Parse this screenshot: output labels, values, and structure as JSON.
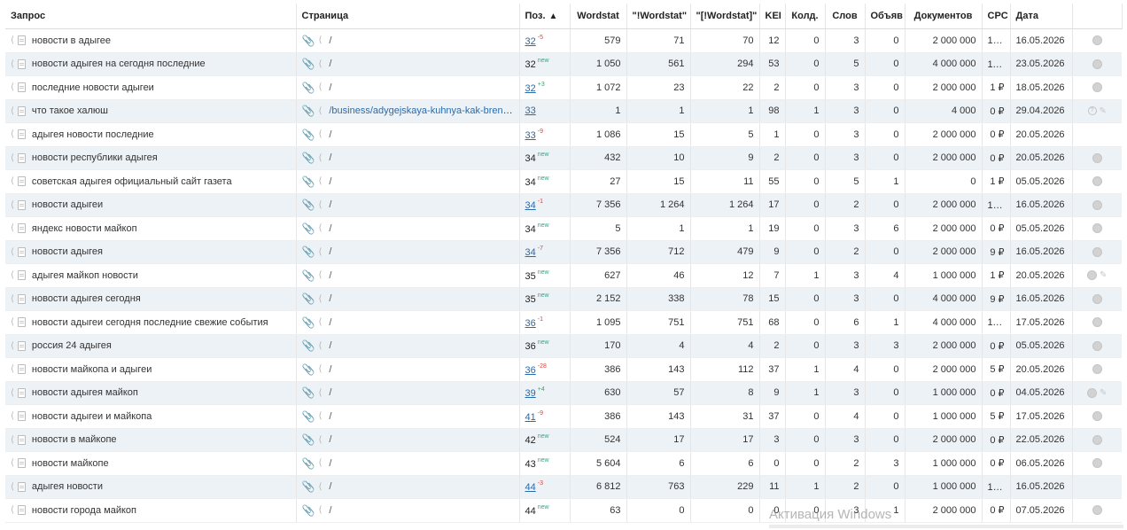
{
  "columns": [
    "Запрос",
    "Страница",
    "Поз.",
    "Wordstat",
    "\"!Wordstat\"",
    "\"[!Wordstat]\"",
    "KEI",
    "Колд.",
    "Слов",
    "Объяв",
    "Документов",
    "CPC",
    "Дата"
  ],
  "rows": [
    {
      "query": "новости в адыгее",
      "page": "/",
      "pos": "32",
      "pos_link": true,
      "delta": "-5",
      "delta_type": "neg",
      "ws": "579",
      "ws2": "71",
      "ws3": "70",
      "kei": "12",
      "kold": "0",
      "slov": "3",
      "obyav": "0",
      "docs": "2 000 000",
      "cpc": "16 ₽",
      "date": "16.05.2026",
      "icons": "globe"
    },
    {
      "query": "новости адыгея на сегодня последние",
      "page": "/",
      "pos": "32",
      "pos_link": false,
      "delta": "new",
      "delta_type": "new",
      "ws": "1 050",
      "ws2": "561",
      "ws3": "294",
      "kei": "53",
      "kold": "0",
      "slov": "5",
      "obyav": "0",
      "docs": "4 000 000",
      "cpc": "11 ₽",
      "date": "23.05.2026",
      "icons": "globe"
    },
    {
      "query": "последние новости адыгеи",
      "page": "/",
      "pos": "32",
      "pos_link": true,
      "delta": "+3",
      "delta_type": "pos",
      "ws": "1 072",
      "ws2": "23",
      "ws3": "22",
      "kei": "2",
      "kold": "0",
      "slov": "3",
      "obyav": "0",
      "docs": "2 000 000",
      "cpc": "1 ₽",
      "date": "18.05.2026",
      "icons": "globe"
    },
    {
      "query": "что такое халюш",
      "page": "/business/adygejskaya-kuhnya-kak-brend...",
      "pos": "33",
      "pos_link": true,
      "delta": "",
      "delta_type": "",
      "ws": "1",
      "ws2": "1",
      "ws3": "1",
      "kei": "98",
      "kold": "1",
      "slov": "3",
      "obyav": "0",
      "docs": "4 000",
      "cpc": "0 ₽",
      "date": "29.04.2026",
      "icons": "help-pen"
    },
    {
      "query": "адыгея новости последние",
      "page": "/",
      "pos": "33",
      "pos_link": true,
      "delta": "-9",
      "delta_type": "neg",
      "ws": "1 086",
      "ws2": "15",
      "ws3": "5",
      "kei": "1",
      "kold": "0",
      "slov": "3",
      "obyav": "0",
      "docs": "2 000 000",
      "cpc": "0 ₽",
      "date": "20.05.2026",
      "icons": ""
    },
    {
      "query": "новости республики адыгея",
      "page": "/",
      "pos": "34",
      "pos_link": false,
      "delta": "new",
      "delta_type": "new",
      "ws": "432",
      "ws2": "10",
      "ws3": "9",
      "kei": "2",
      "kold": "0",
      "slov": "3",
      "obyav": "0",
      "docs": "2 000 000",
      "cpc": "0 ₽",
      "date": "20.05.2026",
      "icons": "globe"
    },
    {
      "query": "советская адыгея официальный сайт газета",
      "page": "/",
      "pos": "34",
      "pos_link": false,
      "delta": "new",
      "delta_type": "new",
      "ws": "27",
      "ws2": "15",
      "ws3": "11",
      "kei": "55",
      "kold": "0",
      "slov": "5",
      "obyav": "1",
      "docs": "0",
      "cpc": "1 ₽",
      "date": "05.05.2026",
      "icons": "globe"
    },
    {
      "query": "новости адыгеи",
      "page": "/",
      "pos": "34",
      "pos_link": true,
      "delta": "-1",
      "delta_type": "neg",
      "ws": "7 356",
      "ws2": "1 264",
      "ws3": "1 264",
      "kei": "17",
      "kold": "0",
      "slov": "2",
      "obyav": "0",
      "docs": "2 000 000",
      "cpc": "10 ₽",
      "date": "16.05.2026",
      "icons": "globe"
    },
    {
      "query": "яндекс новости майкоп",
      "page": "/",
      "pos": "34",
      "pos_link": false,
      "delta": "new",
      "delta_type": "new",
      "ws": "5",
      "ws2": "1",
      "ws3": "1",
      "kei": "19",
      "kold": "0",
      "slov": "3",
      "obyav": "6",
      "docs": "2 000 000",
      "cpc": "0 ₽",
      "date": "05.05.2026",
      "icons": "globe"
    },
    {
      "query": "новости адыгея",
      "page": "/",
      "pos": "34",
      "pos_link": true,
      "delta": "-7",
      "delta_type": "neg",
      "ws": "7 356",
      "ws2": "712",
      "ws3": "479",
      "kei": "9",
      "kold": "0",
      "slov": "2",
      "obyav": "0",
      "docs": "2 000 000",
      "cpc": "9 ₽",
      "date": "16.05.2026",
      "icons": "globe"
    },
    {
      "query": "адыгея майкоп новости",
      "page": "/",
      "pos": "35",
      "pos_link": false,
      "delta": "new",
      "delta_type": "new",
      "ws": "627",
      "ws2": "46",
      "ws3": "12",
      "kei": "7",
      "kold": "1",
      "slov": "3",
      "obyav": "4",
      "docs": "1 000 000",
      "cpc": "1 ₽",
      "date": "20.05.2026",
      "icons": "globe-pen"
    },
    {
      "query": "новости адыгея сегодня",
      "page": "/",
      "pos": "35",
      "pos_link": false,
      "delta": "new",
      "delta_type": "new",
      "ws": "2 152",
      "ws2": "338",
      "ws3": "78",
      "kei": "15",
      "kold": "0",
      "slov": "3",
      "obyav": "0",
      "docs": "4 000 000",
      "cpc": "9 ₽",
      "date": "16.05.2026",
      "icons": "globe"
    },
    {
      "query": "новости адыгеи сегодня последние свежие события",
      "page": "/",
      "pos": "36",
      "pos_link": true,
      "delta": "-1",
      "delta_type": "neg",
      "ws": "1 095",
      "ws2": "751",
      "ws3": "751",
      "kei": "68",
      "kold": "0",
      "slov": "6",
      "obyav": "1",
      "docs": "4 000 000",
      "cpc": "11 ₽",
      "date": "17.05.2026",
      "icons": "globe"
    },
    {
      "query": "россия 24 адыгея",
      "page": "/",
      "pos": "36",
      "pos_link": false,
      "delta": "new",
      "delta_type": "new",
      "ws": "170",
      "ws2": "4",
      "ws3": "4",
      "kei": "2",
      "kold": "0",
      "slov": "3",
      "obyav": "3",
      "docs": "2 000 000",
      "cpc": "0 ₽",
      "date": "05.05.2026",
      "icons": "globe"
    },
    {
      "query": "новости майкопа и адыгеи",
      "page": "/",
      "pos": "36",
      "pos_link": true,
      "delta": "-28",
      "delta_type": "neg",
      "ws": "386",
      "ws2": "143",
      "ws3": "112",
      "kei": "37",
      "kold": "1",
      "slov": "4",
      "obyav": "0",
      "docs": "2 000 000",
      "cpc": "5 ₽",
      "date": "20.05.2026",
      "icons": "globe"
    },
    {
      "query": "новости адыгея майкоп",
      "page": "/",
      "pos": "39",
      "pos_link": true,
      "delta": "+4",
      "delta_type": "pos",
      "ws": "630",
      "ws2": "57",
      "ws3": "8",
      "kei": "9",
      "kold": "1",
      "slov": "3",
      "obyav": "0",
      "docs": "1 000 000",
      "cpc": "0 ₽",
      "date": "04.05.2026",
      "icons": "globe-pen"
    },
    {
      "query": "новости адыгеи и майкопа",
      "page": "/",
      "pos": "41",
      "pos_link": true,
      "delta": "-9",
      "delta_type": "neg",
      "ws": "386",
      "ws2": "143",
      "ws3": "31",
      "kei": "37",
      "kold": "0",
      "slov": "4",
      "obyav": "0",
      "docs": "1 000 000",
      "cpc": "5 ₽",
      "date": "17.05.2026",
      "icons": "globe"
    },
    {
      "query": "новости в майкопе",
      "page": "/",
      "pos": "42",
      "pos_link": false,
      "delta": "new",
      "delta_type": "new",
      "ws": "524",
      "ws2": "17",
      "ws3": "17",
      "kei": "3",
      "kold": "0",
      "slov": "3",
      "obyav": "0",
      "docs": "2 000 000",
      "cpc": "0 ₽",
      "date": "22.05.2026",
      "icons": "globe"
    },
    {
      "query": "новости майкопе",
      "page": "/",
      "pos": "43",
      "pos_link": false,
      "delta": "new",
      "delta_type": "new",
      "ws": "5 604",
      "ws2": "6",
      "ws3": "6",
      "kei": "0",
      "kold": "0",
      "slov": "2",
      "obyav": "3",
      "docs": "1 000 000",
      "cpc": "0 ₽",
      "date": "06.05.2026",
      "icons": "globe"
    },
    {
      "query": "адыгея новости",
      "page": "/",
      "pos": "44",
      "pos_link": true,
      "delta": "-3",
      "delta_type": "neg",
      "ws": "6 812",
      "ws2": "763",
      "ws3": "229",
      "kei": "11",
      "kold": "1",
      "slov": "2",
      "obyav": "0",
      "docs": "1 000 000",
      "cpc": "15 ₽",
      "date": "16.05.2026",
      "icons": ""
    },
    {
      "query": "новости города майкоп",
      "page": "/",
      "pos": "44",
      "pos_link": false,
      "delta": "new",
      "delta_type": "new",
      "ws": "63",
      "ws2": "0",
      "ws3": "0",
      "kei": "0",
      "kold": "0",
      "slov": "3",
      "obyav": "1",
      "docs": "2 000 000",
      "cpc": "0 ₽",
      "date": "07.05.2026",
      "icons": "globe"
    }
  ],
  "watermark": "Активация Windows",
  "colors": {
    "link": "#2a6aa8",
    "delta_negative": "#e0413a",
    "delta_positive": "#3aa06a",
    "delta_new": "#2bab8a",
    "row_alt": "#edf2f7"
  }
}
